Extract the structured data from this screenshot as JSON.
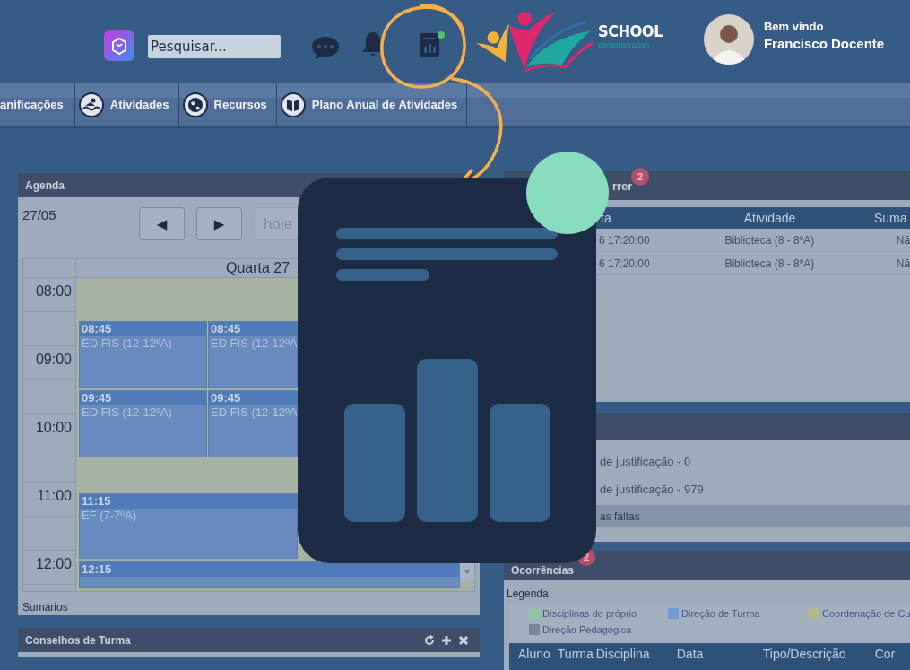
{
  "header": {
    "search": {
      "placeholder": "Pesquisar..."
    },
    "logo": {
      "name": "SCHOOL",
      "tagline": "demonstration"
    },
    "user": {
      "greeting": "Bem vindo",
      "name": "Francisco Docente"
    }
  },
  "nav": [
    {
      "label": "anificações"
    },
    {
      "label": "Atividades"
    },
    {
      "label": "Recursos"
    },
    {
      "label": "Plano Anual de Atividades"
    }
  ],
  "agenda": {
    "title": "Agenda",
    "date": "27/05",
    "prev": "◀",
    "next": "▶",
    "today": "hoje",
    "day_header": "Quarta 27",
    "times": [
      "08:00",
      "09:00",
      "10:00",
      "11:00",
      "12:00"
    ],
    "events": [
      {
        "time": "08:45",
        "title": "ED FIS (12-12ºA)"
      },
      {
        "time": "08:45",
        "title": "ED FIS (12-12ºA"
      },
      {
        "time": "09:45",
        "title": "ED FIS (12-12ºA)"
      },
      {
        "time": "09:45",
        "title": "ED FIS (12-12ºA"
      },
      {
        "time": "11:15",
        "title": "EF (7-7ºA)"
      },
      {
        "time": "12:15"
      }
    ],
    "footer": "Sumários"
  },
  "councils": {
    "title": "Conselhos de Turma"
  },
  "sessions": {
    "title": "rrer",
    "badge": "2",
    "columns": [
      "ta",
      "Atividade",
      "Suma"
    ],
    "rows": [
      [
        "6 17:20:00",
        "Biblioteca (8 - 8ºA)",
        "Nã"
      ],
      [
        "6 17:20:00",
        "Biblioteca (8 - 8ºA)",
        "Nã"
      ]
    ]
  },
  "absences": {
    "lines": [
      "de justificação - 0",
      "de justificação - 979"
    ],
    "link": "as faltas"
  },
  "occurrences": {
    "title": "Ocorrências",
    "badge": "2",
    "legend_label": "Legenda:",
    "legend": [
      {
        "label": "Disciplinas do próprio",
        "color": "#8fc4a6"
      },
      {
        "label": "Direção de Turma",
        "color": "#6e9ad0"
      },
      {
        "label": "Coordenação de Cu",
        "color": "#b2b98a"
      },
      {
        "label": "Direção Pedagógica",
        "color": "#7b8594"
      }
    ],
    "columns": [
      "Aluno",
      "Turma",
      "Disciplina",
      "Data",
      "Tipo/Descrição",
      "Cor"
    ]
  }
}
